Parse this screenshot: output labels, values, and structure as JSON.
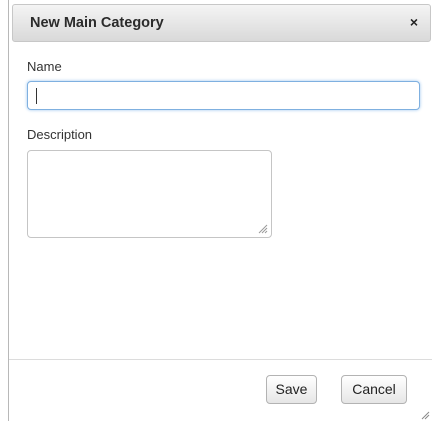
{
  "dialog": {
    "title": "New Main Category",
    "close_label": "×"
  },
  "form": {
    "name_label": "Name",
    "name_value": "",
    "description_label": "Description",
    "description_value": ""
  },
  "buttons": {
    "save_label": "Save",
    "cancel_label": "Cancel"
  },
  "icons": {
    "close": "close-icon",
    "textarea_resize": "resize-grip-icon",
    "dialog_resize": "resize-grip-icon"
  },
  "colors": {
    "focus_border": "#7fb0e0",
    "titlebar_top": "#f4f4f4",
    "titlebar_bottom": "#d9d9d9"
  }
}
